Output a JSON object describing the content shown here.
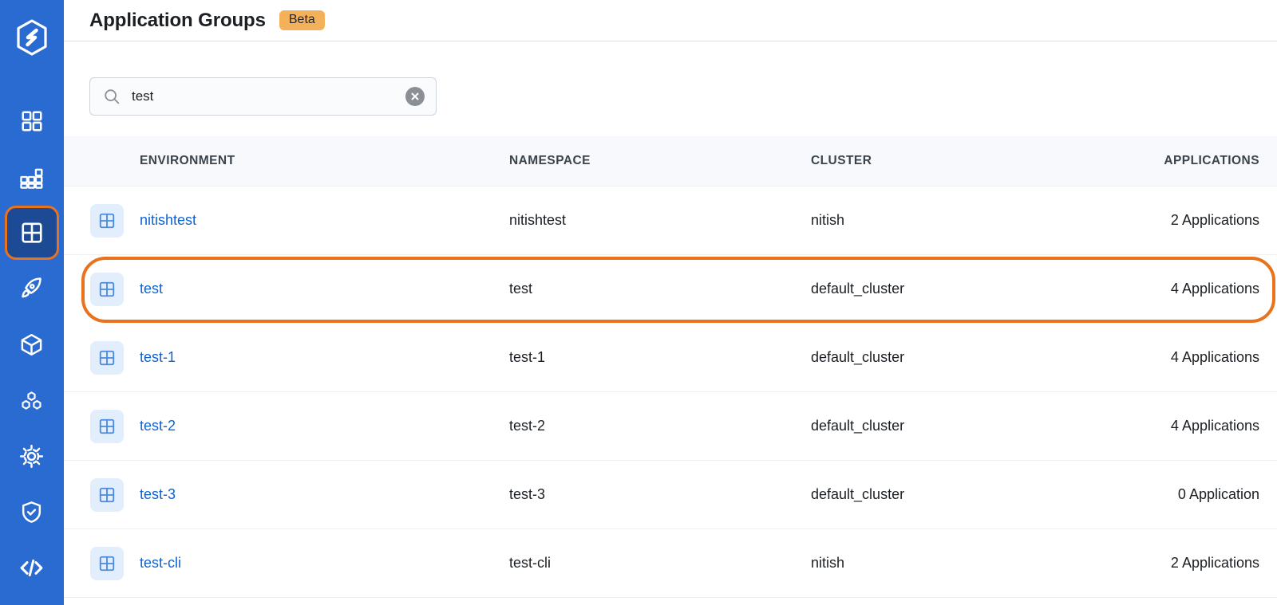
{
  "sidebar": {
    "logo_name": "devtron-logo",
    "brand_color": "#2a6bd1",
    "selected_color": "#1d4a94",
    "selected_border_color": "#e8721d",
    "items": [
      {
        "name": "dashboard",
        "icon": "dashboard-grid-icon",
        "selected": false
      },
      {
        "name": "applications-chart",
        "icon": "bar-chart-icon",
        "selected": false
      },
      {
        "name": "application-groups",
        "icon": "grid-square-icon",
        "selected": true
      },
      {
        "name": "deployments",
        "icon": "rocket-icon",
        "selected": false
      },
      {
        "name": "chart-store",
        "icon": "cube-icon",
        "selected": false
      },
      {
        "name": "resource-browser",
        "icon": "hexagons-icon",
        "selected": false
      },
      {
        "name": "bulk-edit",
        "icon": "gear-sun-icon",
        "selected": false
      },
      {
        "name": "security",
        "icon": "shield-check-icon",
        "selected": false
      },
      {
        "name": "code-editor",
        "icon": "code-brackets-icon",
        "selected": false
      }
    ]
  },
  "header": {
    "title": "Application Groups",
    "badge": "Beta",
    "badge_color": "#f3b15a"
  },
  "search": {
    "value": "test",
    "placeholder": "Search",
    "icon": "search-icon",
    "clear_icon": "clear-circle-icon"
  },
  "table": {
    "columns": [
      {
        "key": "environment",
        "label": "ENVIRONMENT"
      },
      {
        "key": "namespace",
        "label": "NAMESPACE"
      },
      {
        "key": "cluster",
        "label": "CLUSTER"
      },
      {
        "key": "applications",
        "label": "APPLICATIONS"
      }
    ],
    "rows": [
      {
        "icon": "grid-square-icon",
        "environment": "nitishtest",
        "namespace": "nitishtest",
        "cluster": "nitish",
        "applications": "2 Applications",
        "highlighted": false
      },
      {
        "icon": "grid-square-icon",
        "environment": "test",
        "namespace": "test",
        "cluster": "default_cluster",
        "applications": "4 Applications",
        "highlighted": true
      },
      {
        "icon": "grid-square-icon",
        "environment": "test-1",
        "namespace": "test-1",
        "cluster": "default_cluster",
        "applications": "4 Applications",
        "highlighted": false
      },
      {
        "icon": "grid-square-icon",
        "environment": "test-2",
        "namespace": "test-2",
        "cluster": "default_cluster",
        "applications": "4 Applications",
        "highlighted": false
      },
      {
        "icon": "grid-square-icon",
        "environment": "test-3",
        "namespace": "test-3",
        "cluster": "default_cluster",
        "applications": "0 Application",
        "highlighted": false
      },
      {
        "icon": "grid-square-icon",
        "environment": "test-cli",
        "namespace": "test-cli",
        "cluster": "nitish",
        "applications": "2 Applications",
        "highlighted": false
      }
    ]
  }
}
